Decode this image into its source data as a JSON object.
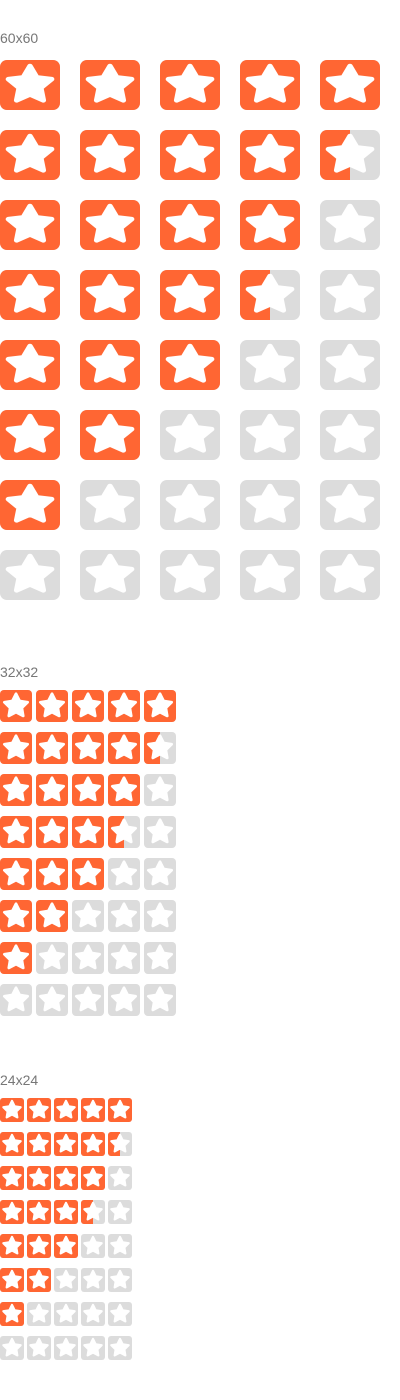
{
  "colors": {
    "filled": "#FF6633",
    "empty": "#DCDCDC",
    "star": "#FFFFFF"
  },
  "icon": "star-icon",
  "sections": [
    {
      "label": "60x60",
      "ratings": [
        5,
        4.5,
        4,
        3.5,
        3,
        2,
        1,
        0
      ]
    },
    {
      "label": "32x32",
      "ratings": [
        5,
        4.5,
        4,
        3.5,
        3,
        2,
        1,
        0
      ]
    },
    {
      "label": "24x24",
      "ratings": [
        5,
        4.5,
        4,
        3.5,
        3,
        2,
        1,
        0
      ]
    }
  ]
}
